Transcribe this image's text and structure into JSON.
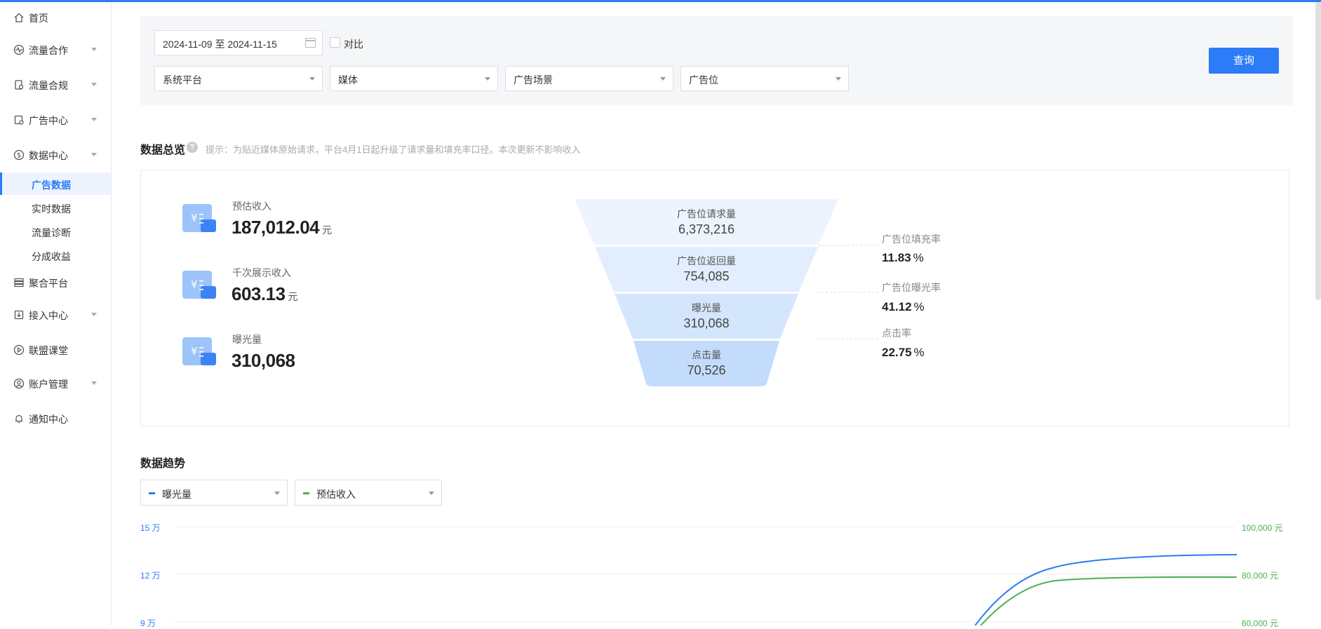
{
  "colors": {
    "accent": "#2b7cf6",
    "series_exposure": "#2b7cf6",
    "series_revenue": "#4caf50"
  },
  "sidebar": {
    "items": [
      {
        "label": "首页",
        "icon": "home-icon"
      },
      {
        "label": "流量合作",
        "icon": "pulse-icon"
      },
      {
        "label": "流量合规",
        "icon": "compliance-icon"
      },
      {
        "label": "广告中心",
        "icon": "ad-center-icon"
      },
      {
        "label": "数据中心",
        "icon": "dollar-icon"
      },
      {
        "label": "聚合平台",
        "icon": "stack-icon"
      },
      {
        "label": "接入中心",
        "icon": "download-icon"
      },
      {
        "label": "联盟课堂",
        "icon": "play-icon"
      },
      {
        "label": "账户管理",
        "icon": "user-icon"
      },
      {
        "label": "通知中心",
        "icon": "bell-icon"
      }
    ],
    "data_sub": [
      "广告数据",
      "实时数据",
      "流量诊断",
      "分成收益"
    ]
  },
  "filters": {
    "date_range": "2024-11-09 至 2024-11-15",
    "compare_label": "对比",
    "platform": "系统平台",
    "media": "媒体",
    "scene": "广告场景",
    "slot": "广告位",
    "query_button": "查询"
  },
  "overview": {
    "title": "数据总览",
    "hint": "提示：为贴近媒体原始请求，平台4月1日起升级了请求量和填充率口径。本次更新不影响收入",
    "metrics": [
      {
        "label": "预估收入",
        "value": "187,012.04",
        "unit": "元"
      },
      {
        "label": "千次展示收入",
        "value": "603.13",
        "unit": "元"
      },
      {
        "label": "曝光量",
        "value": "310,068",
        "unit": ""
      }
    ],
    "funnel": [
      {
        "label": "广告位请求量",
        "value": "6,373,216"
      },
      {
        "label": "广告位返回量",
        "value": "754,085"
      },
      {
        "label": "曝光量",
        "value": "310,068"
      },
      {
        "label": "点击量",
        "value": "70,526"
      }
    ],
    "rates": [
      {
        "label": "广告位填充率",
        "value": "11.83",
        "unit": "%"
      },
      {
        "label": "广告位曝光率",
        "value": "41.12",
        "unit": "%"
      },
      {
        "label": "点击率",
        "value": "22.75",
        "unit": "%"
      }
    ]
  },
  "trend": {
    "title": "数据趋势",
    "metric_left": "曝光量",
    "metric_right": "预估收入",
    "left_ticks": [
      "15 万",
      "12 万",
      "9 万"
    ],
    "right_ticks": [
      "100,000 元",
      "80,000 元",
      "60,000 元"
    ]
  }
}
